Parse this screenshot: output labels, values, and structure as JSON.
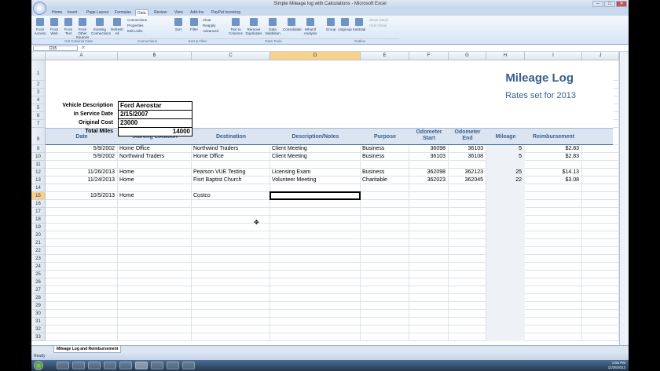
{
  "window": {
    "title": "Simple Mileage log with Calculations - Microsoft Excel",
    "controls": [
      "–",
      "□",
      "✕"
    ]
  },
  "tabs": [
    "Home",
    "Insert",
    "Page Layout",
    "Formulas",
    "Data",
    "Review",
    "View",
    "Add-Ins",
    "PayPal Invoicing"
  ],
  "active_tab": "Data",
  "ribbon": {
    "buttons": [
      "From Access",
      "From Web",
      "From Text",
      "From Other Sources",
      "Existing Connections",
      "Refresh All",
      "Sort",
      "Filter",
      "Text to Columns",
      "Remove Duplicates",
      "Data Validation",
      "Consolidate",
      "What-If Analysis",
      "Group",
      "Ungroup",
      "Subtotal"
    ],
    "small": [
      "Connections",
      "Properties",
      "Edit Links",
      "Clear",
      "Reapply",
      "Advanced",
      "Show Detail",
      "Hide Detail"
    ],
    "groups": [
      "Get External Data",
      "Connections",
      "Sort & Filter",
      "Data Tools",
      "Outline"
    ]
  },
  "namebox": "D15",
  "fx": "fx",
  "columns": [
    "A",
    "B",
    "C",
    "D",
    "E",
    "F",
    "G",
    "H",
    "I",
    "J"
  ],
  "rows": [
    "1",
    "2",
    "3",
    "4",
    "5",
    "6",
    "7",
    "8",
    "9",
    "10",
    "11",
    "12",
    "13",
    "14",
    "15",
    "16",
    "17",
    "18",
    "19",
    "20",
    "21",
    "22",
    "23",
    "24",
    "25",
    "26",
    "27",
    "28",
    "29",
    "30",
    "31",
    "32",
    "33"
  ],
  "sheet": {
    "title": "Mileage Log",
    "subtitle": "Rates set for 2013",
    "vehicle_label": "Vehicle Description",
    "vehicle": "Ford Aerostar",
    "service_label": "In Service Date",
    "service": "2/15/2007",
    "cost_label": "Original Cost",
    "cost": "23000",
    "miles_label": "Total Miles",
    "miles": "14000",
    "headers": [
      "Date",
      "Starting Location",
      "Destination",
      "Description/Notes",
      "Purpose",
      "Odometer Start",
      "Odometer End",
      "Mileage",
      "Reimbursement"
    ],
    "data": [
      [
        "5/9/2002",
        "Home Office",
        "Northwind Traders",
        "Client Meeting",
        "Business",
        "36098",
        "36103",
        "5",
        "$2.83"
      ],
      [
        "5/9/2002",
        "Northwind Traders",
        "Home Office",
        "Client Meeting",
        "Business",
        "36103",
        "36108",
        "5",
        "$2.83"
      ],
      [
        "11/26/2013",
        "Home",
        "Pearson VUE Testing",
        "Licensing Exam",
        "Business",
        "362098",
        "362123",
        "25",
        "$14.13"
      ],
      [
        "11/24/2013",
        "Home",
        "Fisrt Baptist Church",
        "Volunteer Meeting",
        "Charitable",
        "362023",
        "362045",
        "22",
        "$3.08"
      ],
      [
        "10/5/2013",
        "Home",
        "Costco",
        "",
        "",
        "",
        "",
        "",
        ""
      ]
    ]
  },
  "sheet_tab": "Mileage Log and Reimbursement",
  "status": "Ready",
  "clock": [
    "5:56 PM",
    "11/26/2013"
  ]
}
